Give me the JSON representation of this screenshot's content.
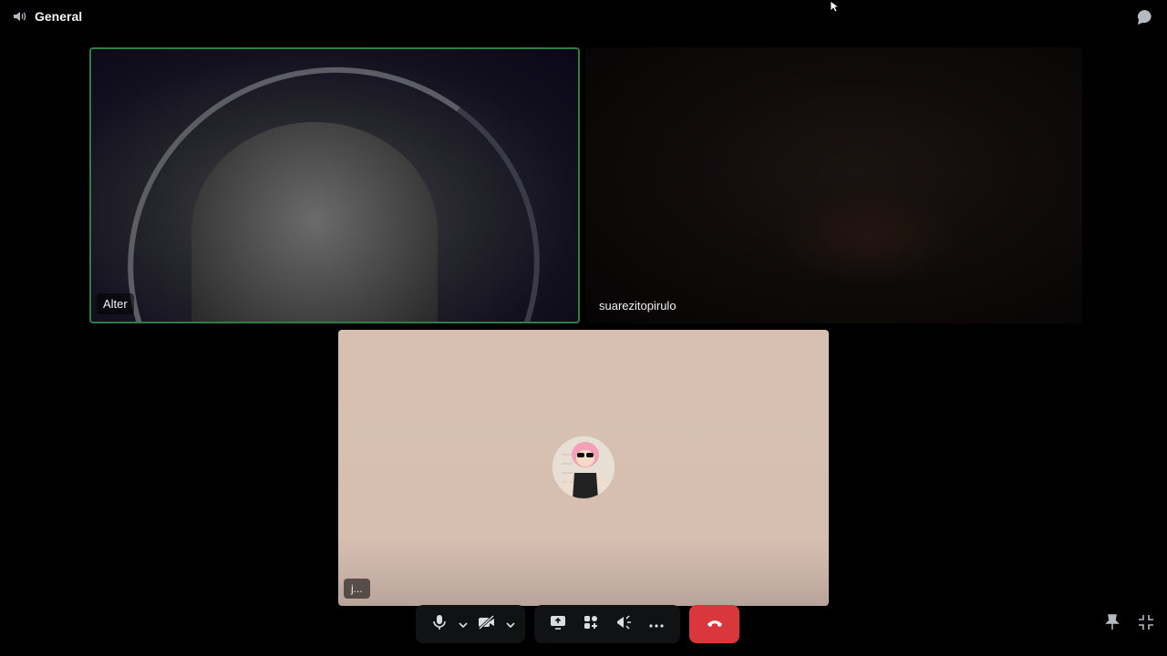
{
  "header": {
    "channel_name": "General"
  },
  "tiles": {
    "alter": {
      "name": "Alter"
    },
    "suarez": {
      "name": "suarezitopirulo"
    },
    "user": {
      "name": "j..."
    }
  },
  "controls": {
    "mic": "microphone-icon",
    "camera": "camera-off-icon",
    "share": "screen-share-icon",
    "activities": "activities-icon",
    "soundboard": "soundboard-icon",
    "more": "more-icon",
    "disconnect": "phone-hangup-icon"
  },
  "colors": {
    "speaking_border": "#2d7d46",
    "hangup": "#da373c",
    "control_bg": "#111214"
  }
}
